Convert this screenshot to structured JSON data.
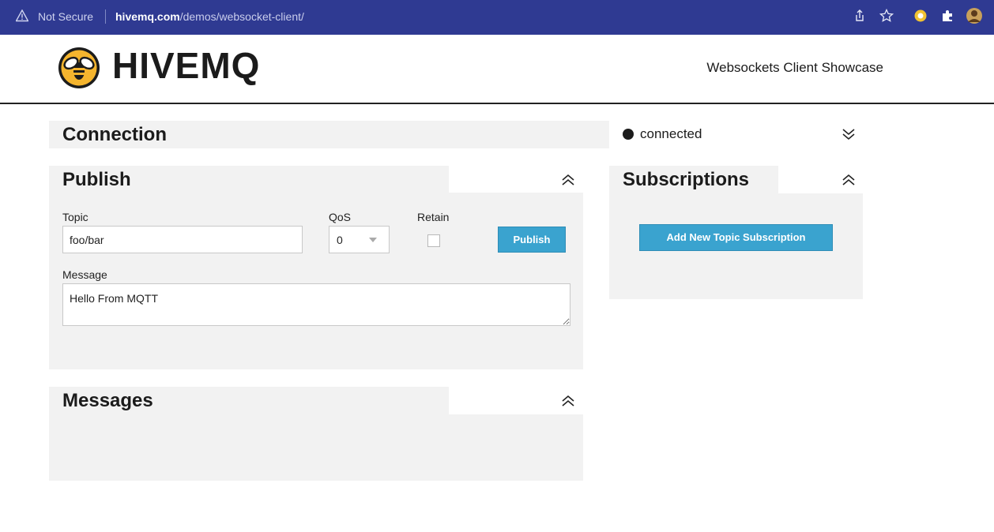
{
  "browser": {
    "security_label": "Not Secure",
    "url_domain": "hivemq.com",
    "url_path": "/demos/websocket-client/",
    "icons": [
      "share-icon",
      "bookmark-star-icon",
      "extension-icon",
      "puzzle-icon",
      "profile-avatar-icon"
    ]
  },
  "header": {
    "logo_text": "HIVEMQ",
    "tagline": "Websockets Client Showcase"
  },
  "connection": {
    "title": "Connection",
    "status": "connected"
  },
  "publish": {
    "title": "Publish",
    "topic_label": "Topic",
    "topic_value": "foo/bar",
    "qos_label": "QoS",
    "qos_value": "0",
    "retain_label": "Retain",
    "retain_checked": false,
    "publish_button": "Publish",
    "message_label": "Message",
    "message_value": "Hello From MQTT"
  },
  "subscriptions": {
    "title": "Subscriptions",
    "add_button": "Add New Topic Subscription"
  },
  "messages": {
    "title": "Messages"
  },
  "colors": {
    "browser_bar": "#2f3a92",
    "button": "#3aa3cf",
    "panel_bg": "#f2f2f2",
    "logo_yellow": "#f5b52e"
  }
}
